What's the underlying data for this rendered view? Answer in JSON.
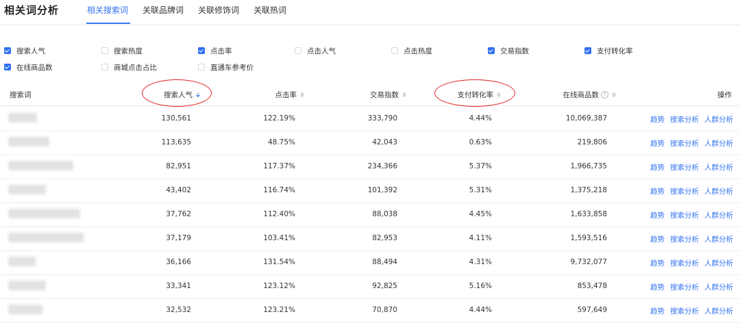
{
  "header": {
    "title": "相关词分析",
    "tabs": [
      {
        "label": "相关搜索词",
        "active": true
      },
      {
        "label": "关联品牌词",
        "active": false
      },
      {
        "label": "关联修饰词",
        "active": false
      },
      {
        "label": "关联热词",
        "active": false
      }
    ]
  },
  "options": [
    {
      "label": "搜索人气",
      "checked": true
    },
    {
      "label": "搜索热度",
      "checked": false
    },
    {
      "label": "点击率",
      "checked": true
    },
    {
      "label": "点击人气",
      "checked": false
    },
    {
      "label": "点击热度",
      "checked": false
    },
    {
      "label": "交易指数",
      "checked": true
    },
    {
      "label": "支付转化率",
      "checked": true
    },
    {
      "label": "在线商品数",
      "checked": true
    },
    {
      "label": "商城点击占比",
      "checked": false
    },
    {
      "label": "直通车参考价",
      "checked": false
    }
  ],
  "table": {
    "columns": [
      "搜索词",
      "搜索人气",
      "点击率",
      "交易指数",
      "支付转化率",
      "在线商品数",
      "操作"
    ],
    "action_labels": [
      "趋势",
      "搜索分析",
      "人群分析"
    ],
    "rows": [
      {
        "popularity": "130,561",
        "ctr": "122.19%",
        "trade": "333,790",
        "conv": "4.44%",
        "items": "10,069,387"
      },
      {
        "popularity": "113,635",
        "ctr": "48.75%",
        "trade": "42,043",
        "conv": "0.63%",
        "items": "219,806"
      },
      {
        "popularity": "82,951",
        "ctr": "117.37%",
        "trade": "234,366",
        "conv": "5.37%",
        "items": "1,966,735"
      },
      {
        "popularity": "43,402",
        "ctr": "116.74%",
        "trade": "101,392",
        "conv": "5.31%",
        "items": "1,375,218"
      },
      {
        "popularity": "37,762",
        "ctr": "112.40%",
        "trade": "88,038",
        "conv": "4.45%",
        "items": "1,633,858"
      },
      {
        "popularity": "37,179",
        "ctr": "103.41%",
        "trade": "82,953",
        "conv": "4.11%",
        "items": "1,593,516"
      },
      {
        "popularity": "36,166",
        "ctr": "131.54%",
        "trade": "88,494",
        "conv": "4.31%",
        "items": "9,732,077"
      },
      {
        "popularity": "33,341",
        "ctr": "123.12%",
        "trade": "92,825",
        "conv": "5.16%",
        "items": "853,478"
      },
      {
        "popularity": "32,532",
        "ctr": "123.21%",
        "trade": "70,870",
        "conv": "4.44%",
        "items": "597,649"
      }
    ]
  },
  "colors": {
    "accent": "#3574f0",
    "annotation": "#e02020"
  },
  "icons": {
    "info": "question-circle-icon",
    "sort": "sort-caret-icon"
  }
}
